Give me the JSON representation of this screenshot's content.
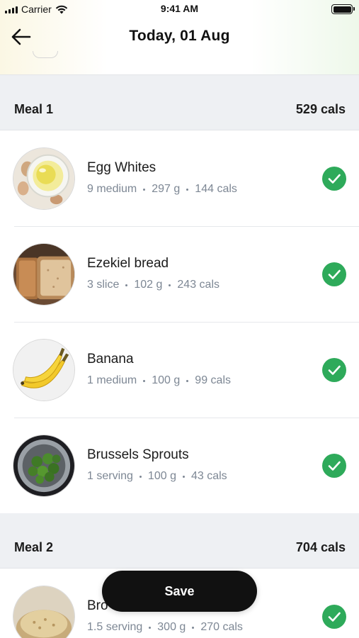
{
  "status_bar": {
    "carrier": "Carrier",
    "time": "9:41 AM"
  },
  "nav": {
    "title": "Today, 01 Aug",
    "back_icon": "arrow-left-icon"
  },
  "meals": [
    {
      "name": "Meal 1",
      "cals": "529 cals",
      "foods": [
        {
          "name": "Egg Whites",
          "qty": "9 medium",
          "weight": "297 g",
          "cals": "144 cals",
          "image": "egg-whites-image",
          "checked": true
        },
        {
          "name": "Ezekiel bread",
          "qty": "3 slice",
          "weight": "102 g",
          "cals": "243 cals",
          "image": "bread-image",
          "checked": true
        },
        {
          "name": "Banana",
          "qty": "1 medium",
          "weight": "100 g",
          "cals": "99 cals",
          "image": "banana-image",
          "checked": true
        },
        {
          "name": "Brussels Sprouts",
          "qty": "1 serving",
          "weight": "100 g",
          "cals": "43 cals",
          "image": "brussels-sprouts-image",
          "checked": true
        }
      ]
    },
    {
      "name": "Meal 2",
      "cals": "704 cals",
      "foods": [
        {
          "name": "Bro",
          "qty": "1.5 serving",
          "weight": "300 g",
          "cals": "270 cals",
          "image": "rice-image",
          "checked": true
        }
      ]
    }
  ],
  "save_label": "Save",
  "colors": {
    "check": "#2eaa5a",
    "meal_header_bg": "#eef0f3",
    "meta_text": "#7d8794",
    "save_bg": "#111111"
  }
}
